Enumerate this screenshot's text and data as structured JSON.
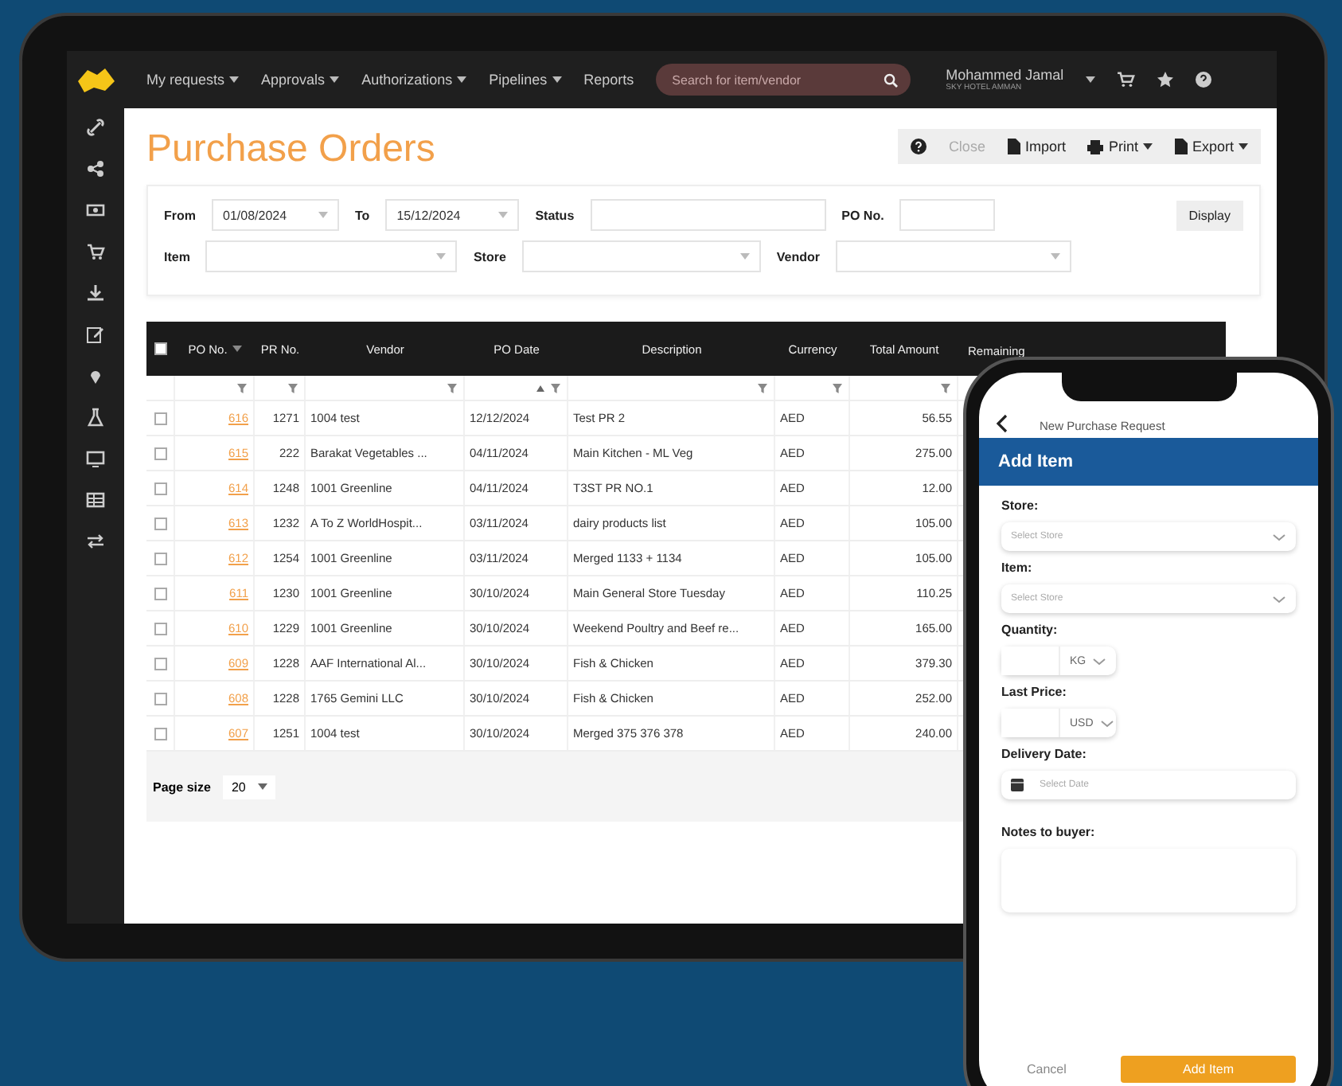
{
  "nav": {
    "menus": [
      "My requests",
      "Approvals",
      "Authorizations",
      "Pipelines"
    ],
    "reports": "Reports",
    "search": {
      "placeholder": "Search for item/vendor"
    },
    "user": {
      "name": "Mohammed Jamal",
      "org": "SKY HOTEL AMMAN"
    }
  },
  "page": {
    "title": "Purchase Orders",
    "toolbar": [
      {
        "kind": "help"
      },
      {
        "kind": "plain",
        "label": "Close",
        "disabled": true
      },
      {
        "kind": "import",
        "label": "Import",
        "disabled": false
      },
      {
        "kind": "print",
        "label": "Print",
        "disabled": false
      },
      {
        "kind": "export",
        "label": "Export",
        "disabled": false
      }
    ]
  },
  "filters": {
    "from_label": "From",
    "from": "01/08/2024",
    "to_label": "To",
    "to": "15/12/2024",
    "status_label": "Status",
    "po_label": "PO No.",
    "display": "Display",
    "item_label": "Item",
    "store_label": "Store",
    "vendor_label": "Vendor"
  },
  "table": {
    "select_all_checked": false,
    "columns": [
      "PO No.",
      "PR No.",
      "Vendor",
      "PO Date",
      "Description",
      "Currency",
      "Total Amount",
      "Remaining"
    ],
    "rows": [
      {
        "checked": false,
        "po": "616",
        "pr": "1271",
        "vendor": "1004 test",
        "date": "12/12/2024",
        "desc": "Test PR 2",
        "currency": "AED",
        "amount": "56.55"
      },
      {
        "checked": false,
        "po": "615",
        "pr": "222",
        "vendor": "Barakat Vegetables ...",
        "date": "04/11/2024",
        "desc": "Main Kitchen - ML Veg",
        "currency": "AED",
        "amount": "275.00"
      },
      {
        "checked": false,
        "po": "614",
        "pr": "1248",
        "vendor": "1001 Greenline",
        "date": "04/11/2024",
        "desc": "T3ST PR NO.1",
        "currency": "AED",
        "amount": "12.00"
      },
      {
        "checked": false,
        "po": "613",
        "pr": "1232",
        "vendor": "A To Z WorldHospit...",
        "date": "03/11/2024",
        "desc": "dairy products list",
        "currency": "AED",
        "amount": "105.00"
      },
      {
        "checked": false,
        "po": "612",
        "pr": "1254",
        "vendor": "1001 Greenline",
        "date": "03/11/2024",
        "desc": "Merged 1133 + 1134",
        "currency": "AED",
        "amount": "105.00"
      },
      {
        "checked": false,
        "po": "611",
        "pr": "1230",
        "vendor": "1001 Greenline",
        "date": "30/10/2024",
        "desc": "Main General Store Tuesday",
        "currency": "AED",
        "amount": "110.25"
      },
      {
        "checked": false,
        "po": "610",
        "pr": "1229",
        "vendor": "1001 Greenline",
        "date": "30/10/2024",
        "desc": "Weekend Poultry and Beef re...",
        "currency": "AED",
        "amount": "165.00"
      },
      {
        "checked": false,
        "po": "609",
        "pr": "1228",
        "vendor": "AAF International Al...",
        "date": "30/10/2024",
        "desc": "Fish & Chicken",
        "currency": "AED",
        "amount": "379.30"
      },
      {
        "checked": false,
        "po": "608",
        "pr": "1228",
        "vendor": "1765 Gemini LLC",
        "date": "30/10/2024",
        "desc": "Fish & Chicken",
        "currency": "AED",
        "amount": "252.00"
      },
      {
        "checked": false,
        "po": "607",
        "pr": "1251",
        "vendor": "1004 test",
        "date": "30/10/2024",
        "desc": "Merged 375 376 378",
        "currency": "AED",
        "amount": "240.00"
      }
    ],
    "page_size_label": "Page size",
    "page_size": "20"
  },
  "phone": {
    "title": "New Purchase Request",
    "heading": "Add Item",
    "fields": [
      {
        "kind": "select",
        "label": "Store:",
        "placeholder": "Select Store"
      },
      {
        "kind": "select",
        "label": "Item:",
        "placeholder": "Select Store"
      },
      {
        "kind": "unit",
        "label": "Quantity:",
        "unit": "KG"
      },
      {
        "kind": "unit",
        "label": "Last Price:",
        "unit": "USD"
      },
      {
        "kind": "date",
        "label": "Delivery Date:",
        "placeholder": "Select Date"
      },
      {
        "kind": "textarea",
        "label": "Notes to buyer:"
      }
    ],
    "cancel": "Cancel",
    "submit": "Add Item"
  }
}
